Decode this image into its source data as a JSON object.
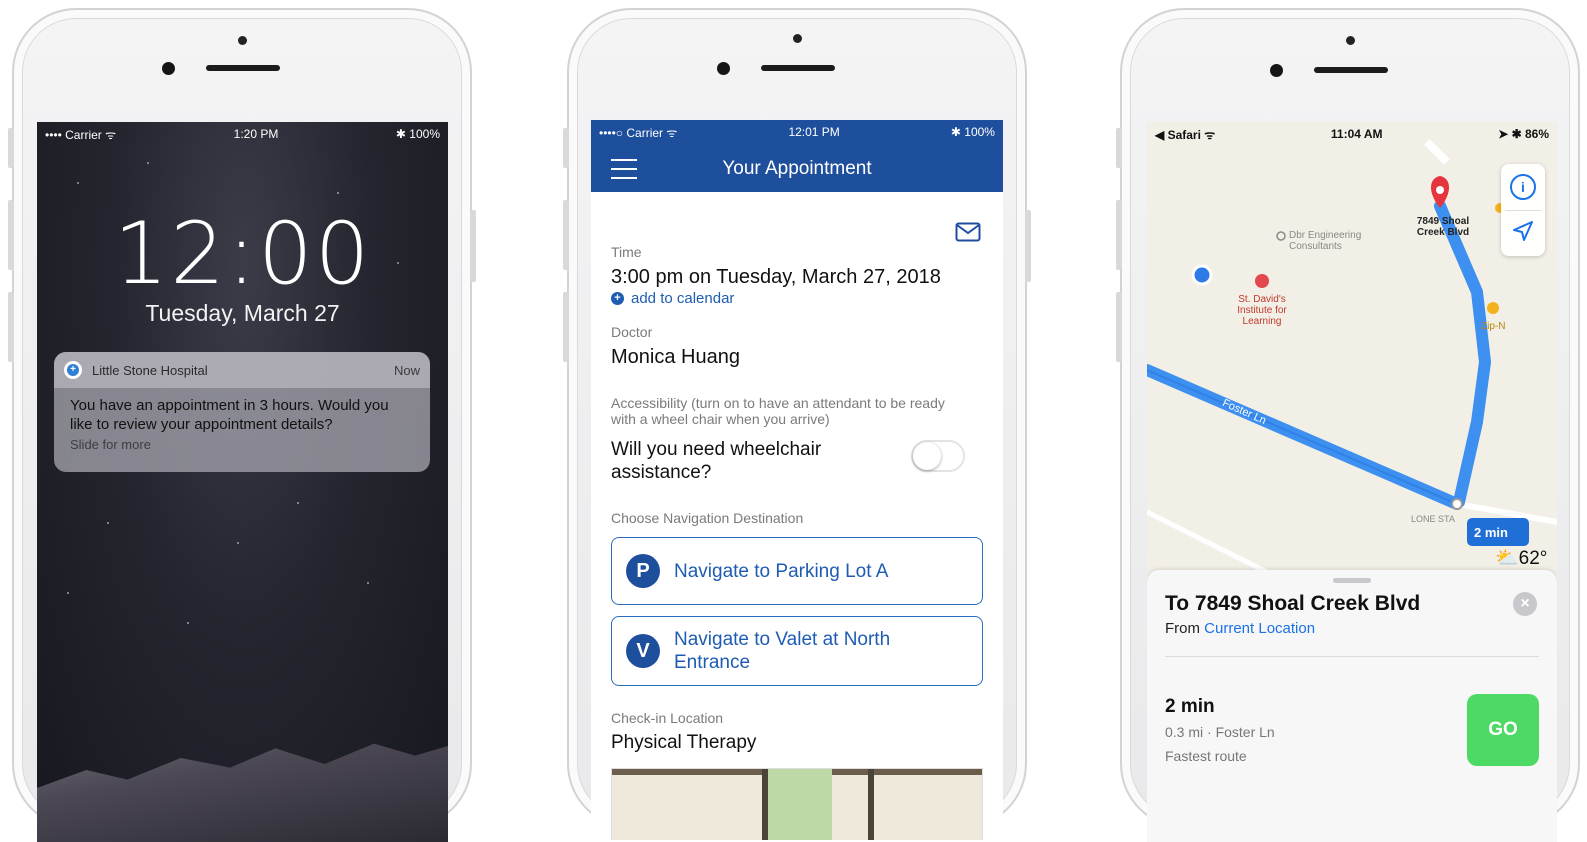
{
  "phone1": {
    "status": {
      "carrier": "•••• Carrier ᯤ",
      "time": "1:20 PM",
      "battery": "✱ 100%"
    },
    "lock_time": "12:00",
    "lock_date": "Tuesday, March 27",
    "notification": {
      "app": "Little Stone Hospital",
      "when": "Now",
      "message": "You have an appointment in 3 hours. Would you like to review your appointment details?",
      "hint": "Slide for more"
    }
  },
  "phone2": {
    "status": {
      "carrier": "••••○ Carrier ᯤ",
      "time": "12:01 PM",
      "battery": "✱ 100%"
    },
    "title": "Your Appointment",
    "time_label": "Time",
    "time_value": "3:00 pm on Tuesday, March 27, 2018",
    "add_calendar": "add to calendar",
    "doctor_label": "Doctor",
    "doctor_value": "Monica Huang",
    "access_label": "Accessibility (turn on to have an attendant to be ready with a wheel chair when you arrive)",
    "wheelchair_q": "Will you need wheelchair assistance?",
    "wheelchair_on": false,
    "nav_label": "Choose Navigation Destination",
    "nav_options": [
      {
        "badge": "P",
        "label": "Navigate to Parking Lot A"
      },
      {
        "badge": "V",
        "label": "Navigate to Valet at North Entrance"
      }
    ],
    "checkin_label": "Check-in Location",
    "checkin_value": "Physical Therapy"
  },
  "phone3": {
    "status": {
      "back": "◀ Safari ᯤ",
      "time": "11:04 AM",
      "battery": "➤ ✱ 86%"
    },
    "map": {
      "destination_pin": "7849 Shoal Creek Blvd",
      "poi1": "Dbr Engineering Consultants",
      "poi2": "St. David's Institute for Learning",
      "poi3": "Zip-N",
      "road1": "Foster Ln",
      "road2": "LONE STA",
      "eta_badge": "2 min",
      "weather": "62°"
    },
    "sheet": {
      "title": "To 7849 Shoal Creek Blvd",
      "from_prefix": "From ",
      "from_value": "Current Location",
      "route_time": "2 min",
      "route_detail": "0.3 mi · Foster Ln",
      "route_note": "Fastest route",
      "go": "GO"
    }
  }
}
